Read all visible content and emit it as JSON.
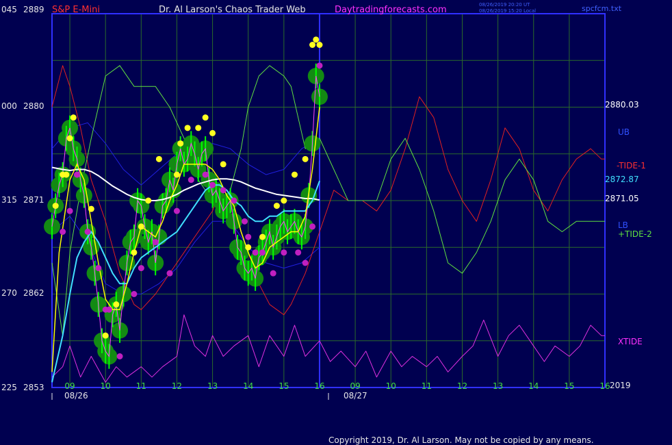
{
  "header": {
    "instrument": "S&P E-Mini",
    "site": "Dr. Al Larson's Chaos Trader Web",
    "url": "Daytradingforecasts.com",
    "file": "spcfcm.txt",
    "stamp1": "08/26/2019 20:20 UT",
    "stamp2": "08/26/2019 15:20 Local"
  },
  "left_axis": [
    {
      "code": "045",
      "price": "2889"
    },
    {
      "code": "000",
      "price": "2880"
    },
    {
      "code": "315",
      "price": "2871"
    },
    {
      "code": "270",
      "price": "2862"
    },
    {
      "code": "225",
      "price": "2853"
    }
  ],
  "right_labels": {
    "last": "2880.03",
    "ub": "UB",
    "tide1": "-TIDE-1",
    "mid": "2872.87",
    "avg": "2871.05",
    "lb": "LB",
    "tide2": "+TIDE-2",
    "xtide": "XTIDE",
    "year": "2019"
  },
  "time_axis": {
    "hours": [
      "09",
      "10",
      "11",
      "12",
      "13",
      "14",
      "15",
      "16",
      "09",
      "10",
      "11",
      "12",
      "13",
      "14",
      "15",
      "16"
    ],
    "dates": [
      "08/26",
      "08/27"
    ]
  },
  "copyright": "Copyright 2019, Dr. Al Larson. May not be copied by any means.",
  "colors": {
    "background": "#000050",
    "grid": "#2a6a2a",
    "frame": "#3030ff",
    "price": "#00ff00",
    "ema_fast": "#ffff00",
    "ema_mid": "#40e0ff",
    "ema_slow": "#ffffff",
    "tide1": "#e02020",
    "tide2": "#60e040",
    "bands": "#2020e0",
    "xtide": "#e030e0"
  },
  "chart_data": {
    "type": "line",
    "title": "S&P E-Mini",
    "ylim": [
      2853,
      2889
    ],
    "xlim": [
      8.5,
      24
    ],
    "y_ticks": [
      2853,
      2862,
      2871,
      2880,
      2889
    ],
    "now_x": 16,
    "grid": true,
    "series": [
      {
        "name": "price",
        "x": [
          8.5,
          8.6,
          8.7,
          8.8,
          8.9,
          9.0,
          9.1,
          9.2,
          9.3,
          9.4,
          9.5,
          9.6,
          9.7,
          9.8,
          9.9,
          10.0,
          10.1,
          10.2,
          10.3,
          10.4,
          10.5,
          10.6,
          10.7,
          10.8,
          10.9,
          11.0,
          11.1,
          11.2,
          11.3,
          11.4,
          11.5,
          11.6,
          11.7,
          11.8,
          11.9,
          12.0,
          12.1,
          12.2,
          12.3,
          12.4,
          12.5,
          12.6,
          12.7,
          12.8,
          12.9,
          13.0,
          13.1,
          13.2,
          13.3,
          13.4,
          13.5,
          13.6,
          13.7,
          13.8,
          13.9,
          14.0,
          14.1,
          14.2,
          14.3,
          14.4,
          14.5,
          14.6,
          14.7,
          14.8,
          14.9,
          15.0,
          15.1,
          15.2,
          15.3,
          15.4,
          15.5,
          15.6,
          15.7,
          15.8,
          15.9,
          16.0
        ],
        "values": [
          2868.5,
          2870.5,
          2872.5,
          2873.5,
          2877.0,
          2878.0,
          2876.0,
          2875.0,
          2873.0,
          2871.5,
          2868.0,
          2866.5,
          2864.0,
          2861.0,
          2857.5,
          2856.5,
          2856.0,
          2860.0,
          2861.0,
          2858.5,
          2862.0,
          2865.0,
          2867.0,
          2867.5,
          2871.0,
          2870.5,
          2868.5,
          2867.0,
          2868.0,
          2865.0,
          2867.5,
          2870.5,
          2871.0,
          2873.0,
          2872.0,
          2874.5,
          2876.0,
          2874.5,
          2875.0,
          2876.5,
          2875.5,
          2874.0,
          2875.5,
          2876.0,
          2873.0,
          2871.5,
          2872.0,
          2871.0,
          2870.0,
          2870.5,
          2871.0,
          2869.0,
          2866.5,
          2866.0,
          2864.5,
          2864.0,
          2864.5,
          2863.5,
          2865.5,
          2866.0,
          2867.0,
          2868.0,
          2866.5,
          2867.5,
          2868.5,
          2869.0,
          2868.0,
          2868.5,
          2869.0,
          2868.0,
          2867.5,
          2868.5,
          2871.5,
          2876.5,
          2883.0,
          2881.0
        ]
      },
      {
        "name": "fast average",
        "x": [
          8.5,
          8.7,
          9.0,
          9.2,
          9.4,
          9.6,
          9.8,
          10.0,
          10.2,
          10.4,
          10.6,
          10.8,
          11.0,
          11.2,
          11.4,
          11.6,
          11.8,
          12.0,
          12.2,
          12.4,
          12.6,
          12.8,
          13.0,
          13.2,
          13.4,
          13.6,
          13.8,
          14.0,
          14.2,
          14.4,
          14.6,
          14.8,
          15.0,
          15.2,
          15.4,
          15.6,
          15.8,
          16.0
        ],
        "values": [
          2854.5,
          2866,
          2873,
          2874.5,
          2873,
          2869,
          2865,
          2861.5,
          2860.5,
          2860.5,
          2863,
          2866,
          2868.5,
          2868,
          2867.5,
          2869,
          2871,
          2872.5,
          2874.5,
          2874.5,
          2874.5,
          2874.5,
          2874,
          2873,
          2871.5,
          2870.5,
          2868,
          2866,
          2864.5,
          2865,
          2866.5,
          2867,
          2867.5,
          2868,
          2868,
          2869.5,
          2874,
          2880
        ]
      },
      {
        "name": "mid average",
        "x": [
          8.5,
          8.8,
          9.0,
          9.2,
          9.4,
          9.6,
          9.8,
          10.0,
          10.2,
          10.4,
          10.6,
          10.8,
          11.0,
          11.2,
          11.4,
          11.6,
          11.8,
          12.0,
          12.2,
          12.4,
          12.6,
          12.8,
          13.0,
          13.2,
          13.4,
          13.6,
          13.8,
          14.0,
          14.2,
          14.4,
          14.6,
          14.8,
          15.0,
          15.2,
          15.4,
          15.6,
          15.8,
          16.0
        ],
        "values": [
          2853.5,
          2858,
          2862,
          2865.5,
          2867,
          2868,
          2867,
          2865.5,
          2864,
          2863,
          2863,
          2864.5,
          2865.5,
          2866,
          2866.5,
          2867,
          2867.5,
          2868,
          2869,
          2870,
          2871,
          2872,
          2872.5,
          2872.5,
          2872,
          2871,
          2870.5,
          2869.5,
          2869,
          2869,
          2869.5,
          2869.5,
          2870,
          2870,
          2870,
          2870,
          2871,
          2872.9
        ]
      },
      {
        "name": "slow average",
        "x": [
          8.5,
          8.8,
          9.0,
          9.2,
          9.4,
          9.6,
          9.8,
          10.0,
          10.2,
          10.4,
          10.6,
          10.8,
          11.0,
          11.2,
          11.4,
          11.6,
          11.8,
          12.0,
          12.2,
          12.4,
          12.6,
          12.8,
          13.0,
          13.2,
          13.4,
          13.6,
          13.8,
          14.0,
          14.2,
          14.4,
          14.6,
          14.8,
          15.0,
          15.2,
          15.4,
          15.6,
          15.8,
          16.0
        ],
        "values": [
          2874.2,
          2874,
          2873.9,
          2874,
          2874,
          2873.8,
          2873.4,
          2872.9,
          2872.4,
          2872,
          2871.6,
          2871.3,
          2871.1,
          2871,
          2871,
          2871.1,
          2871.3,
          2871.6,
          2872,
          2872.3,
          2872.6,
          2872.8,
          2873,
          2873.1,
          2873.1,
          2873,
          2872.8,
          2872.5,
          2872.2,
          2872,
          2871.8,
          2871.6,
          2871.5,
          2871.4,
          2871.3,
          2871.2,
          2871.2,
          2871.05
        ]
      },
      {
        "name": "-TIDE-1",
        "x": [
          8.5,
          8.8,
          9.0,
          9.3,
          9.6,
          10.0,
          10.4,
          10.8,
          11.0,
          11.4,
          11.8,
          12.2,
          12.6,
          13.0,
          13.2,
          13.5,
          13.8,
          14.0,
          14.3,
          14.6,
          15.0,
          15.2,
          15.6,
          16.0,
          16.4,
          16.8,
          17.2,
          17.6,
          18.0,
          18.4,
          18.8,
          19.2,
          19.6,
          20.0,
          20.4,
          20.8,
          21.2,
          21.6,
          22.0,
          22.4,
          22.8,
          23.2,
          23.6,
          23.9,
          24.0
        ],
        "values": [
          2880,
          2884,
          2882,
          2878,
          2873,
          2869,
          2864,
          2861,
          2860.5,
          2862,
          2864,
          2866,
          2868,
          2870,
          2872,
          2871,
          2868,
          2866,
          2863,
          2861,
          2860,
          2861,
          2864,
          2868,
          2872,
          2871,
          2871,
          2870,
          2872,
          2876,
          2881,
          2879,
          2874,
          2871,
          2869,
          2873,
          2878,
          2876,
          2872,
          2870,
          2873,
          2875,
          2876,
          2875,
          2875
        ]
      },
      {
        "name": "+TIDE-2",
        "x": [
          8.5,
          8.8,
          9.0,
          9.3,
          9.6,
          10.0,
          10.4,
          10.8,
          11.0,
          11.4,
          11.8,
          12.2,
          12.6,
          13.0,
          13.2,
          13.5,
          13.8,
          14.0,
          14.3,
          14.6,
          15.0,
          15.2,
          15.6,
          16.0,
          16.4,
          16.8,
          17.2,
          17.6,
          18.0,
          18.4,
          18.8,
          19.2,
          19.6,
          20.0,
          20.4,
          20.8,
          21.2,
          21.6,
          22.0,
          22.4,
          22.8,
          23.2,
          23.6,
          23.9,
          24.0
        ],
        "values": [
          2865,
          2858,
          2866,
          2872,
          2877,
          2883,
          2884,
          2882,
          2882,
          2882,
          2880,
          2877,
          2873,
          2871,
          2870,
          2872,
          2876,
          2880,
          2883,
          2884,
          2883,
          2882,
          2876,
          2877,
          2874,
          2871,
          2871,
          2871,
          2875,
          2877,
          2874,
          2870,
          2865,
          2864,
          2866,
          2869,
          2873,
          2875,
          2873,
          2869,
          2868,
          2869,
          2869,
          2869,
          2869
        ]
      },
      {
        "name": "UB",
        "x": [
          8.5,
          9.0,
          9.5,
          10.0,
          10.5,
          11.0,
          11.5,
          12.0,
          12.5,
          13.0,
          13.5,
          14.0,
          14.5,
          15.0,
          15.5,
          16.0
        ],
        "values": [
          2876,
          2878,
          2878.5,
          2876.5,
          2874,
          2872.5,
          2874,
          2875.5,
          2876,
          2876.5,
          2876,
          2874.5,
          2873.5,
          2874,
          2876,
          2877
        ]
      },
      {
        "name": "LB",
        "x": [
          8.5,
          9.0,
          9.5,
          10.0,
          10.5,
          11.0,
          11.5,
          12.0,
          12.5,
          13.0,
          13.5,
          14.0,
          14.5,
          15.0,
          15.5,
          16.0
        ],
        "values": [
          2868,
          2869.5,
          2867,
          2863,
          2862,
          2862,
          2863,
          2864.5,
          2867,
          2869,
          2869,
          2866.5,
          2865,
          2864.5,
          2865,
          2866.5
        ]
      },
      {
        "name": "XTIDE",
        "x": [
          8.5,
          8.8,
          9.0,
          9.3,
          9.6,
          10.0,
          10.3,
          10.6,
          11.0,
          11.3,
          11.6,
          12.0,
          12.2,
          12.5,
          12.8,
          13.0,
          13.3,
          13.6,
          14.0,
          14.3,
          14.6,
          15.0,
          15.3,
          15.6,
          16.0,
          16.3,
          16.6,
          17.0,
          17.3,
          17.6,
          18.0,
          18.3,
          18.6,
          19.0,
          19.3,
          19.6,
          20.0,
          20.3,
          20.6,
          21.0,
          21.3,
          21.6,
          22.0,
          22.3,
          22.6,
          23.0,
          23.3,
          23.6,
          23.9,
          24.0
        ],
        "values": [
          2854,
          2855,
          2857,
          2854,
          2856,
          2853.5,
          2855,
          2854,
          2855,
          2854,
          2855,
          2856,
          2860,
          2857,
          2856,
          2858,
          2856,
          2857,
          2858,
          2855,
          2858,
          2856,
          2859,
          2856,
          2857.5,
          2855.5,
          2856.5,
          2855,
          2856.5,
          2854,
          2856.5,
          2855,
          2856,
          2855,
          2856,
          2854.5,
          2856,
          2857,
          2859.5,
          2856,
          2858,
          2859,
          2857,
          2855.5,
          2857,
          2856,
          2857,
          2859,
          2858,
          2858
        ]
      },
      {
        "name": "highs",
        "x": [
          8.6,
          8.8,
          8.9,
          9.0,
          9.1,
          9.6,
          10.0,
          10.3,
          10.8,
          11.0,
          11.2,
          11.5,
          12.0,
          12.1,
          12.3,
          12.6,
          12.8,
          13.0,
          13.3,
          14.0,
          14.4,
          14.8,
          15.0,
          15.3,
          15.6,
          15.8,
          15.9,
          16.0
        ],
        "values": [
          2870.5,
          2873.5,
          2873.5,
          2877,
          2879,
          2870.2,
          2858,
          2861,
          2866,
          2868.5,
          2871,
          2875,
          2873.5,
          2876.5,
          2878,
          2878,
          2879,
          2877.5,
          2874.5,
          2866.5,
          2867.5,
          2870.5,
          2871,
          2873.5,
          2875,
          2886,
          2886.5,
          2886
        ]
      },
      {
        "name": "lows",
        "x": [
          8.8,
          9.0,
          9.2,
          9.5,
          9.8,
          10.0,
          10.1,
          10.4,
          10.8,
          11.0,
          11.4,
          11.8,
          12.0,
          12.4,
          12.8,
          13.0,
          13.3,
          13.6,
          13.9,
          14.0,
          14.2,
          14.4,
          14.7,
          15.0,
          15.4,
          15.6,
          15.8,
          16.0
        ],
        "values": [
          2868,
          2870,
          2873.5,
          2868,
          2864.5,
          2860.5,
          2860.5,
          2856,
          2862,
          2864.5,
          2867,
          2864,
          2870,
          2873,
          2873.5,
          2872.5,
          2872,
          2871,
          2869,
          2867.5,
          2866,
          2866,
          2864,
          2866,
          2866,
          2865,
          2868.5,
          2884
        ]
      }
    ]
  }
}
